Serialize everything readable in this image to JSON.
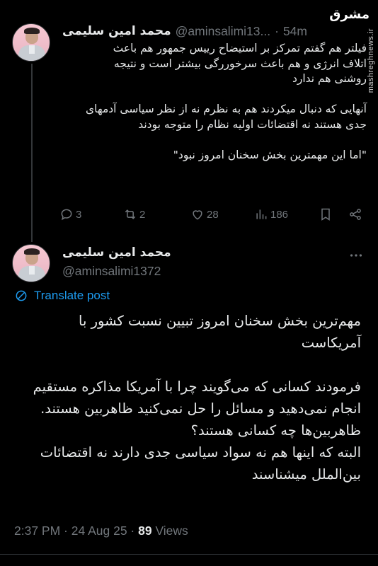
{
  "tweet1": {
    "name": "محمد امین سلیمی",
    "handle": "@aminsalimi13...",
    "separator": "·",
    "time": "54m",
    "text": "فیلتر هم گفتم تمرکز بر استیضاح رییس جمهور هم باعث\nاتلاف انرژی و هم باعث سرخوررگی بیشتر است و نتیجه\nروشنی هم ندارد\n\nآنهایی که دنبال میکردند هم به نظرم نه از نظر سیاسی آدمهای\nجدی هستند نه اقتضائات اولیه نظام را متوجه بودند\n\n\"اما این مهمترین بخش سخنان امروز نبود\"",
    "replies": "3",
    "reposts": "2",
    "likes": "28",
    "views": "186"
  },
  "tweet2": {
    "name": "محمد امین سلیمی",
    "handle": "@aminsalimi1372",
    "translate_label": "Translate post",
    "text": "مهم‌ترین بخش سخنان امروز تبیین نسبت کشور با\nآمریکاست\n\nفرمودند کسانی که می‌گویند چرا با آمریکا مذاکره مستقیم\nانجام نمی‌دهید و مسائل را حل نمی‌کنید ظاهربین هستند.\nظاهربین‌ها چه کسانی هستند؟\nالبته که اینها هم نه سواد سیاسی جدی دارند نه اقتضائات\nبین‌الملل میشناسند",
    "timestamp": "2:37 PM · 24 Aug 25 · ",
    "views_count": "89",
    "views_label": " Views"
  },
  "watermark": {
    "logo": "مشرق",
    "site": "mashreghnews.ir"
  },
  "colors": {
    "background": "#000000",
    "text": "#e7e9ea",
    "secondary": "#71767b",
    "accent": "#1d9bf0"
  },
  "icons": {
    "reply": "reply-icon",
    "repost": "repost-icon",
    "like": "heart-icon",
    "views": "views-chart-icon",
    "bookmark": "bookmark-icon",
    "share": "share-icon",
    "translate": "translate-icon",
    "more": "more-dots-icon"
  }
}
